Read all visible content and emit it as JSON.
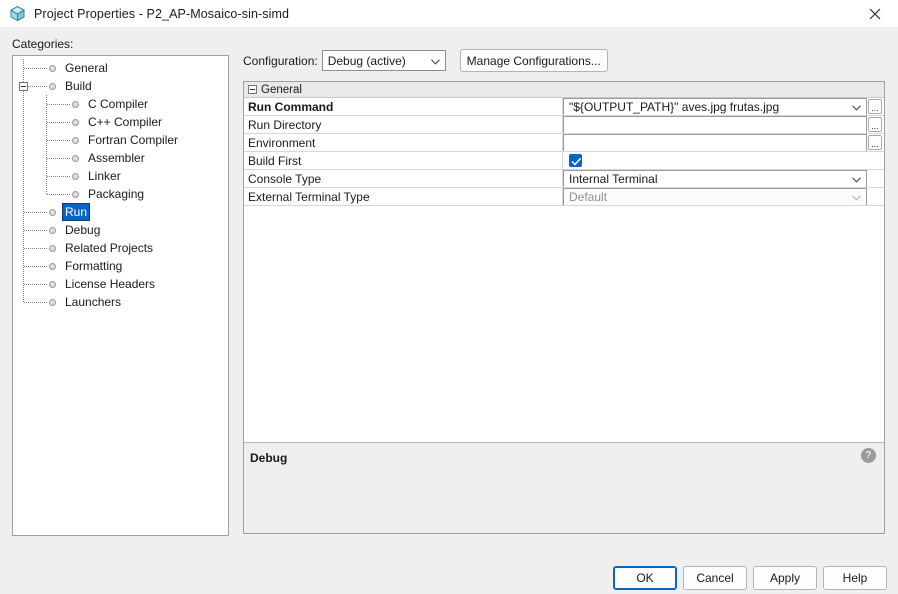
{
  "window": {
    "title": "Project Properties - P2_AP-Mosaico-sin-simd",
    "icon": "cube-icon",
    "close_icon": "close-icon"
  },
  "categories": {
    "label": "Categories:",
    "items": [
      {
        "label": "General",
        "level": 0,
        "selected": false,
        "expander": "none"
      },
      {
        "label": "Build",
        "level": 0,
        "selected": false,
        "expander": "minus"
      },
      {
        "label": "C Compiler",
        "level": 1,
        "selected": false,
        "expander": "none"
      },
      {
        "label": "C++ Compiler",
        "level": 1,
        "selected": false,
        "expander": "none"
      },
      {
        "label": "Fortran Compiler",
        "level": 1,
        "selected": false,
        "expander": "none"
      },
      {
        "label": "Assembler",
        "level": 1,
        "selected": false,
        "expander": "none"
      },
      {
        "label": "Linker",
        "level": 1,
        "selected": false,
        "expander": "none"
      },
      {
        "label": "Packaging",
        "level": 1,
        "selected": false,
        "expander": "none"
      },
      {
        "label": "Run",
        "level": 0,
        "selected": true,
        "expander": "none"
      },
      {
        "label": "Debug",
        "level": 0,
        "selected": false,
        "expander": "none"
      },
      {
        "label": "Related Projects",
        "level": 0,
        "selected": false,
        "expander": "none"
      },
      {
        "label": "Formatting",
        "level": 0,
        "selected": false,
        "expander": "none"
      },
      {
        "label": "License Headers",
        "level": 0,
        "selected": false,
        "expander": "none"
      },
      {
        "label": "Launchers",
        "level": 0,
        "selected": false,
        "expander": "none"
      }
    ]
  },
  "configuration": {
    "label": "Configuration:",
    "selected": "Debug (active)",
    "dropdown_icon": "chevron-down-icon",
    "manage_button": "Manage Configurations..."
  },
  "properties": {
    "group_title": "General",
    "rows": [
      {
        "name": "Run Command",
        "value": "\"${OUTPUT_PATH}\" aves.jpg frutas.jpg",
        "modified": true,
        "editor": "combo-browse"
      },
      {
        "name": "Run Directory",
        "value": "",
        "modified": false,
        "editor": "text-browse"
      },
      {
        "name": "Environment",
        "value": "",
        "modified": false,
        "editor": "text-browse"
      },
      {
        "name": "Build First",
        "value": "",
        "modified": false,
        "editor": "checkbox",
        "checked": true
      },
      {
        "name": "Console Type",
        "value": "Internal Terminal",
        "modified": false,
        "editor": "combo"
      },
      {
        "name": "External Terminal Type",
        "value": "Default",
        "modified": false,
        "editor": "combo",
        "disabled": true
      }
    ],
    "browse_label": "...",
    "description_title": "Debug",
    "help_icon": "help-icon",
    "help_label": "?"
  },
  "footer": {
    "ok": "OK",
    "cancel": "Cancel",
    "apply": "Apply",
    "help": "Help"
  },
  "colors": {
    "accent": "#0a64c8",
    "dialog_bg": "#efefef",
    "panel_bg": "#ffffff"
  }
}
